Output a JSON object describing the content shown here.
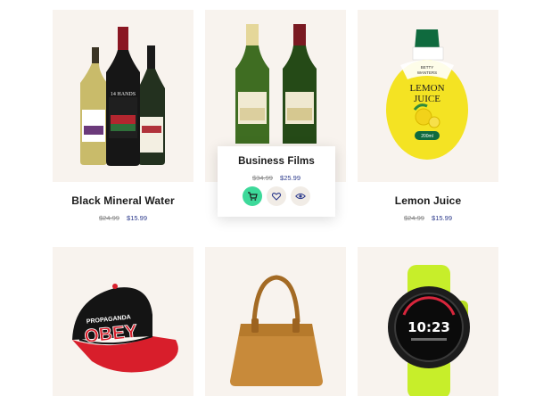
{
  "products": [
    {
      "title": "Black Mineral Water",
      "old_price": "$24.99",
      "new_price": "$15.99",
      "image": "wine-bottles-trio"
    },
    {
      "title": "Business Films",
      "old_price": "$34.99",
      "new_price": "$25.99",
      "image": "wine-bottles-pair"
    },
    {
      "title": "Lemon Juice",
      "old_price": "$24.99",
      "new_price": "$15.99",
      "image": "lemon-juice-bottle",
      "label": {
        "brand_top": "BETTY",
        "brand_bottom": "WANTERS",
        "line1": "LEMON",
        "line2": "JUICE",
        "volume": "200ml"
      }
    },
    {
      "title": "",
      "image": "baseball-cap",
      "cap_text_top": "PROPAGANDA",
      "cap_text_main": "OBEY"
    },
    {
      "title": "",
      "image": "leather-handbag"
    },
    {
      "title": "",
      "image": "sports-watch",
      "watch_time": "10:23"
    }
  ],
  "wine_label_text": "14 HANDS",
  "actions": {
    "cart": "add-to-cart",
    "wishlist": "wishlist",
    "quick_view": "quick-view"
  },
  "colors": {
    "card_bg": "#f8f3ee",
    "accent_green": "#3dd99a",
    "price_new": "#2c3a8c"
  }
}
